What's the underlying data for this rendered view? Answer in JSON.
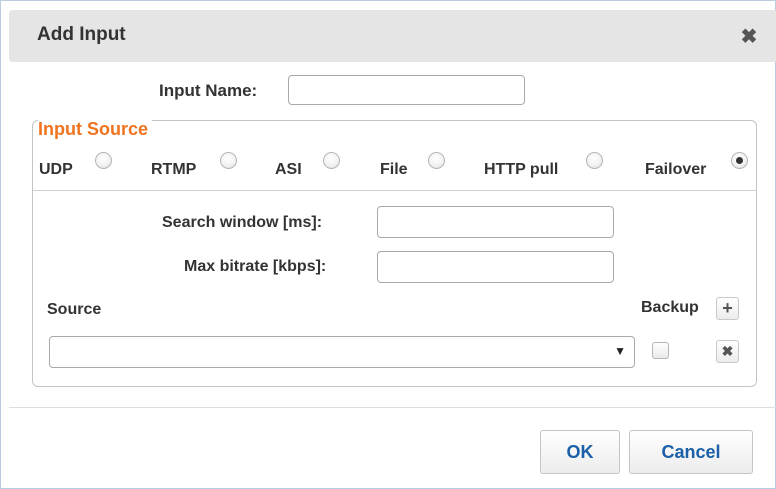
{
  "dialog": {
    "title": "Add Input",
    "close_icon": "close-x-icon"
  },
  "input_name": {
    "label": "Input Name:",
    "value": ""
  },
  "input_source": {
    "legend": "Input Source",
    "options": [
      {
        "label": "UDP",
        "checked": false
      },
      {
        "label": "RTMP",
        "checked": false
      },
      {
        "label": "ASI",
        "checked": false
      },
      {
        "label": "File",
        "checked": false
      },
      {
        "label": "HTTP pull",
        "checked": false
      },
      {
        "label": "Failover",
        "checked": true
      }
    ],
    "search_window": {
      "label": "Search window [ms]:",
      "value": ""
    },
    "max_bitrate": {
      "label": "Max bitrate [kbps]:",
      "value": ""
    },
    "source_header": "Source",
    "backup_header": "Backup",
    "add_backup_icon": "plus-icon",
    "rows": [
      {
        "source": "",
        "backup": false,
        "remove_icon": "close-x-icon"
      }
    ]
  },
  "buttons": {
    "ok": "OK",
    "cancel": "Cancel"
  },
  "colors": {
    "legend": "#f0731f",
    "button_text": "#1a5fa8",
    "titlebar": "#e5e5e5"
  }
}
